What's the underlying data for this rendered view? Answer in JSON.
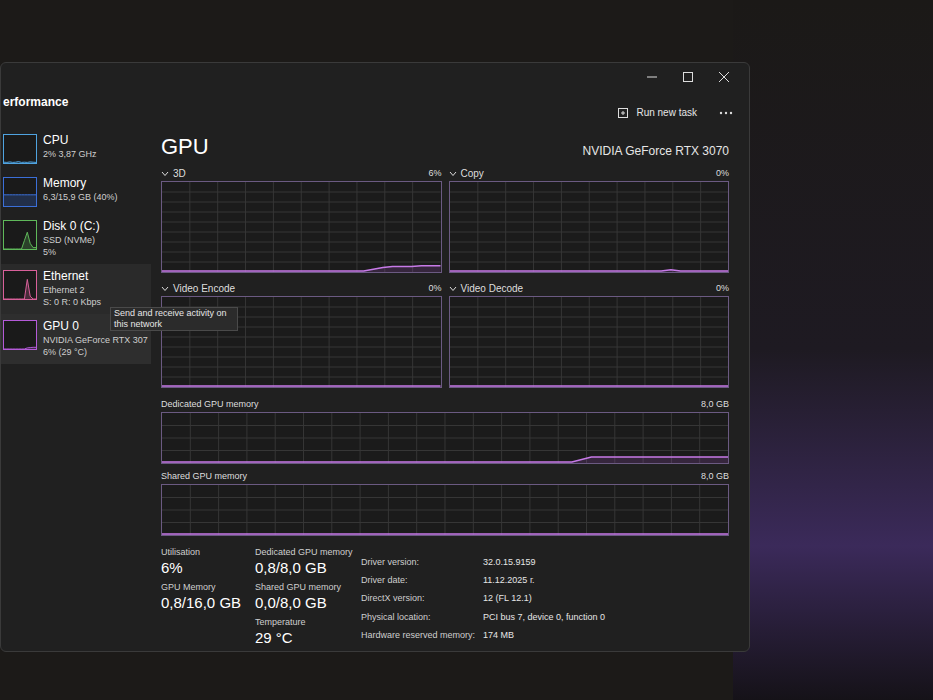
{
  "window": {
    "title": "erformance"
  },
  "header": {
    "run_task": "Run new task"
  },
  "sidebar": {
    "items": [
      {
        "name": "CPU",
        "details": [
          "2% 3,87 GHz"
        ],
        "spark": [
          3,
          2,
          4,
          2,
          3,
          5,
          2,
          3,
          2,
          4,
          3,
          2
        ],
        "color": "#4fa3e0",
        "selected": false,
        "hovered": false
      },
      {
        "name": "Memory",
        "details": [
          "6,3/15,9 GB (40%)"
        ],
        "spark": [
          40,
          40,
          40,
          40,
          40,
          40,
          40,
          40,
          40,
          40,
          40,
          40
        ],
        "color": "#3b6fd8",
        "selected": false,
        "hovered": false
      },
      {
        "name": "Disk 0 (C:)",
        "details": [
          "SSD (NVMe)",
          "5%"
        ],
        "spark": [
          0,
          0,
          0,
          0,
          0,
          0,
          0,
          30,
          60,
          20,
          5,
          5
        ],
        "color": "#5fb85a",
        "selected": false,
        "hovered": false
      },
      {
        "name": "Ethernet",
        "details": [
          "Ethernet 2",
          "S: 0 R: 0 Kbps"
        ],
        "spark": [
          0,
          0,
          0,
          0,
          0,
          0,
          0,
          0,
          70,
          10,
          0,
          0
        ],
        "color": "#d8609a",
        "selected": false,
        "hovered": true
      },
      {
        "name": "GPU 0",
        "details": [
          "NVIDIA GeForce RTX 307",
          "6% (29 °C)"
        ],
        "spark": [
          0,
          0,
          0,
          0,
          0,
          0,
          0,
          0,
          4,
          5,
          6,
          6
        ],
        "color": "#b45ad8",
        "selected": true,
        "hovered": false
      }
    ]
  },
  "tooltip": {
    "text": "Send and receive activity on this network"
  },
  "gpu": {
    "title": "GPU",
    "device": "NVIDIA GeForce RTX 3070",
    "engines": [
      {
        "label": "3D",
        "reading": "6%",
        "max": 100,
        "values": [
          0,
          0,
          0,
          0,
          0,
          0,
          0,
          0,
          0,
          0,
          0,
          0,
          0,
          0,
          0,
          0,
          0,
          0,
          0,
          0,
          0,
          0,
          2,
          4,
          5,
          5,
          5,
          6,
          6,
          6
        ]
      },
      {
        "label": "Copy",
        "reading": "0%",
        "max": 100,
        "values": [
          0,
          0,
          0,
          0,
          0,
          0,
          0,
          0,
          0,
          0,
          0,
          0,
          0,
          0,
          0,
          0,
          0,
          0,
          0,
          0,
          0,
          0,
          0,
          1.5,
          0,
          0,
          0,
          0,
          0,
          0
        ]
      },
      {
        "label": "Video Encode",
        "reading": "0%",
        "max": 100,
        "values": [
          0,
          0,
          0,
          0,
          0,
          0,
          0,
          0,
          0,
          0,
          0,
          0,
          0,
          0,
          0,
          0,
          0,
          0,
          0,
          0,
          0,
          0,
          0,
          0,
          0,
          0,
          0,
          0,
          0,
          0
        ]
      },
      {
        "label": "Video Decode",
        "reading": "0%",
        "max": 100,
        "values": [
          0,
          0,
          0,
          0,
          0,
          0,
          0,
          0,
          0,
          0,
          0,
          0,
          0,
          0,
          0,
          0,
          0,
          0,
          0,
          0,
          0,
          0,
          0,
          0,
          0,
          0,
          0,
          0,
          0,
          0
        ]
      }
    ],
    "memory": [
      {
        "label": "Dedicated GPU memory",
        "reading": "8,0 GB",
        "max": 8,
        "values": [
          0,
          0,
          0,
          0,
          0,
          0,
          0,
          0,
          0,
          0,
          0,
          0,
          0,
          0,
          0,
          0,
          0,
          0,
          0,
          0,
          0,
          0,
          0.8,
          0.8,
          0.8,
          0.8,
          0.8,
          0.8,
          0.8,
          0.8
        ]
      },
      {
        "label": "Shared GPU memory",
        "reading": "8,0 GB",
        "max": 8,
        "values": [
          0,
          0,
          0,
          0,
          0,
          0,
          0,
          0,
          0,
          0,
          0,
          0,
          0,
          0,
          0,
          0,
          0,
          0,
          0,
          0,
          0,
          0,
          0,
          0,
          0,
          0,
          0,
          0,
          0,
          0
        ]
      }
    ],
    "stats": [
      [
        {
          "label": "Utilisation",
          "value": "6%"
        },
        {
          "label": "GPU Memory",
          "value": "0,8/16,0 GB"
        }
      ],
      [
        {
          "label": "Dedicated GPU memory",
          "value": "0,8/8,0 GB"
        },
        {
          "label": "Shared GPU memory",
          "value": "0,0/8,0 GB"
        },
        {
          "label": "Temperature",
          "value": "29 °C"
        }
      ]
    ],
    "details": [
      {
        "label": "Driver version:",
        "value": "32.0.15.9159"
      },
      {
        "label": "Driver date:",
        "value": "11.12.2025 г."
      },
      {
        "label": "DirectX version:",
        "value": "12 (FL 12.1)"
      },
      {
        "label": "Physical location:",
        "value": "PCI bus 7, device 0, function 0"
      },
      {
        "label": "Hardware reserved memory:",
        "value": "174 MB"
      }
    ]
  }
}
